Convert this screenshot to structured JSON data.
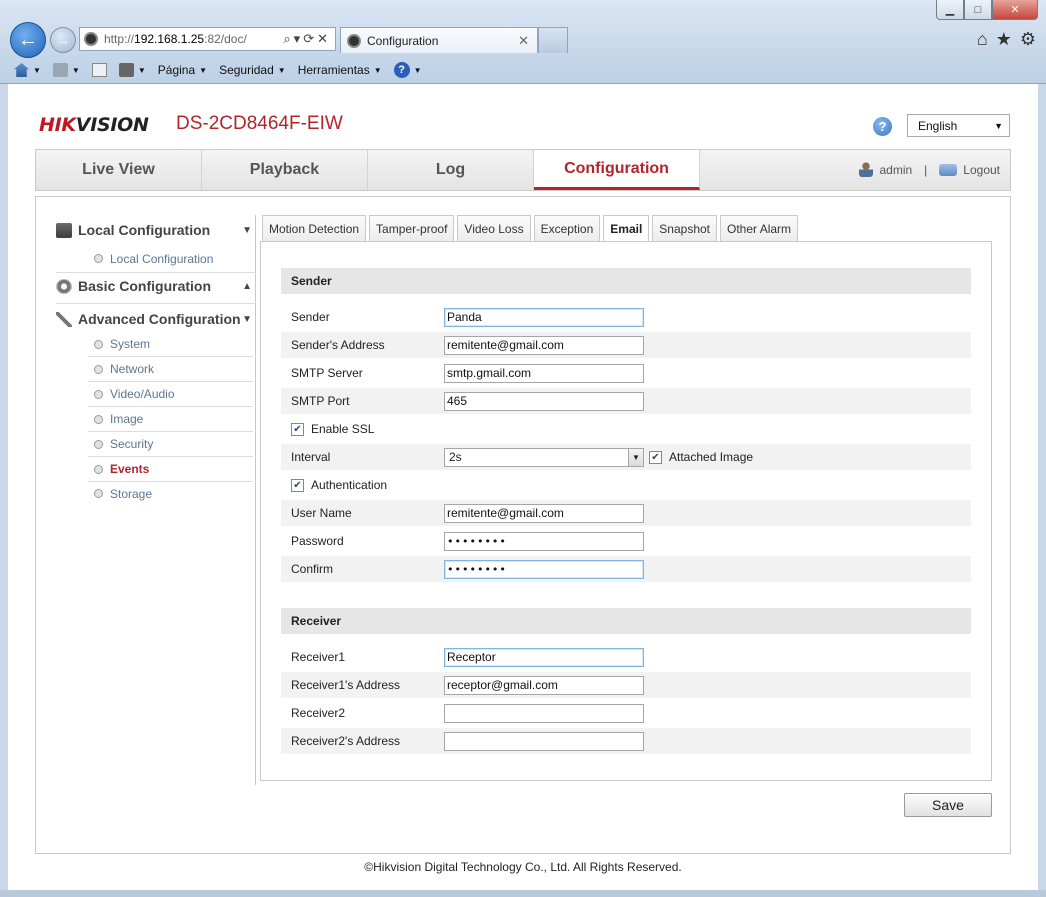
{
  "browser": {
    "url_prefix": "http://",
    "url_host": "192.168.1.25",
    "url_rest": ":82/doc/",
    "tab_title": "Configuration",
    "menu": [
      "Página",
      "Seguridad",
      "Herramientas"
    ]
  },
  "header": {
    "logo_red": "HIK",
    "logo_dark": "VISION",
    "model": "DS-2CD8464F-EIW",
    "language": "English",
    "help": "?"
  },
  "mainnav": {
    "tabs": [
      "Live View",
      "Playback",
      "Log",
      "Configuration"
    ],
    "user": "admin",
    "separator": "|",
    "logout": "Logout"
  },
  "sidebar": {
    "local_config": "Local Configuration",
    "local_sub": "Local Configuration",
    "basic_config": "Basic Configuration",
    "advanced_config": "Advanced Configuration",
    "advanced_items": [
      "System",
      "Network",
      "Video/Audio",
      "Image",
      "Security",
      "Events",
      "Storage"
    ]
  },
  "subtabs": [
    "Motion Detection",
    "Tamper-proof",
    "Video Loss",
    "Exception",
    "Email",
    "Snapshot",
    "Other Alarm"
  ],
  "sender": {
    "header": "Sender",
    "sender_label": "Sender",
    "sender_value": "Panda",
    "address_label": "Sender's Address",
    "address_value": "remitente@gmail.com",
    "smtp_server_label": "SMTP Server",
    "smtp_server_value": "smtp.gmail.com",
    "smtp_port_label": "SMTP Port",
    "smtp_port_value": "465",
    "ssl_label": "Enable SSL",
    "interval_label": "Interval",
    "interval_value": "2s",
    "attached_label": "Attached Image",
    "auth_label": "Authentication",
    "username_label": "User Name",
    "username_value": "remitente@gmail.com",
    "password_label": "Password",
    "password_value": "••••••••",
    "confirm_label": "Confirm",
    "confirm_value": "••••••••"
  },
  "receiver": {
    "header": "Receiver",
    "r1_label": "Receiver1",
    "r1_value": "Receptor",
    "r1_addr_label": "Receiver1's Address",
    "r1_addr_value": "receptor@gmail.com",
    "r2_label": "Receiver2",
    "r2_value": "",
    "r2_addr_label": "Receiver2's Address",
    "r2_addr_value": ""
  },
  "save_label": "Save",
  "footer": "©Hikvision Digital Technology Co., Ltd. All Rights Reserved."
}
